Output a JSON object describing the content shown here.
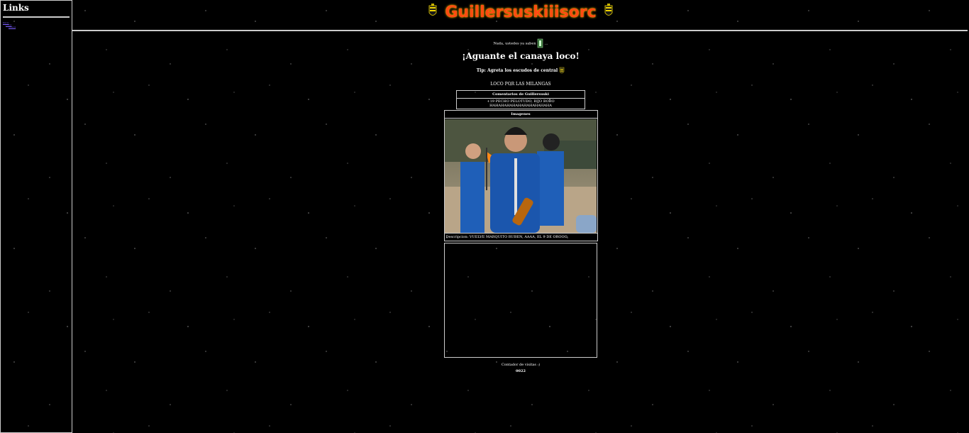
{
  "sidebar": {
    "title": "Links",
    "links": [
      "Inicio",
      "Fotos",
      "Videos"
    ]
  },
  "banner": {
    "title": "Guillersuskiiisorc"
  },
  "main": {
    "small_line": "Nada, ustedes ya saben",
    "headline": "¡Aguante el canaya loco!",
    "tip": "Tip: Agreta los escudos de central",
    "loco": "LOCO POR LAS MILANGAS",
    "comments": {
      "header": "Comentarios de Guillersuski",
      "body": "+19 PECHO PELOTUDO, RIJO BOBO HAHAHAHAHAHAHAHAHAHAHA"
    },
    "image": {
      "header": "Imagenes",
      "description": "Descripcion: VUELVE MARQUITO RUBEN, AAAA, EL 9 DE OROOO."
    },
    "counter": {
      "label": "Contador de visitas :)",
      "value": "0022"
    }
  },
  "colors": {
    "background": "#000000",
    "border": "#cccccc",
    "link": "#7b5cff",
    "banner_text": "#ff4b12",
    "banner_glow": "#ffb000",
    "jersey_blue": "#1f5fb8"
  }
}
